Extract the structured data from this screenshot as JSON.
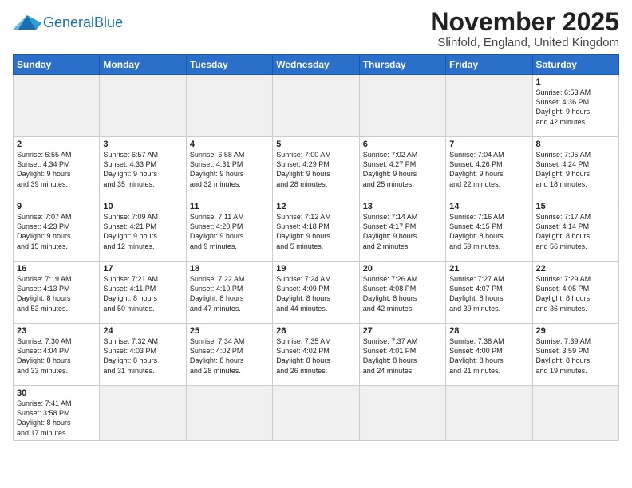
{
  "header": {
    "logo_general": "General",
    "logo_blue": "Blue",
    "month": "November 2025",
    "location": "Slinfold, England, United Kingdom"
  },
  "days_of_week": [
    "Sunday",
    "Monday",
    "Tuesday",
    "Wednesday",
    "Thursday",
    "Friday",
    "Saturday"
  ],
  "weeks": [
    [
      {
        "day": "",
        "info": "",
        "empty": true
      },
      {
        "day": "",
        "info": "",
        "empty": true
      },
      {
        "day": "",
        "info": "",
        "empty": true
      },
      {
        "day": "",
        "info": "",
        "empty": true
      },
      {
        "day": "",
        "info": "",
        "empty": true
      },
      {
        "day": "",
        "info": "",
        "empty": true
      },
      {
        "day": "1",
        "info": "Sunrise: 6:53 AM\nSunset: 4:36 PM\nDaylight: 9 hours\nand 42 minutes.",
        "empty": false
      }
    ],
    [
      {
        "day": "2",
        "info": "Sunrise: 6:55 AM\nSunset: 4:34 PM\nDaylight: 9 hours\nand 39 minutes.",
        "empty": false
      },
      {
        "day": "3",
        "info": "Sunrise: 6:57 AM\nSunset: 4:33 PM\nDaylight: 9 hours\nand 35 minutes.",
        "empty": false
      },
      {
        "day": "4",
        "info": "Sunrise: 6:58 AM\nSunset: 4:31 PM\nDaylight: 9 hours\nand 32 minutes.",
        "empty": false
      },
      {
        "day": "5",
        "info": "Sunrise: 7:00 AM\nSunset: 4:29 PM\nDaylight: 9 hours\nand 28 minutes.",
        "empty": false
      },
      {
        "day": "6",
        "info": "Sunrise: 7:02 AM\nSunset: 4:27 PM\nDaylight: 9 hours\nand 25 minutes.",
        "empty": false
      },
      {
        "day": "7",
        "info": "Sunrise: 7:04 AM\nSunset: 4:26 PM\nDaylight: 9 hours\nand 22 minutes.",
        "empty": false
      },
      {
        "day": "8",
        "info": "Sunrise: 7:05 AM\nSunset: 4:24 PM\nDaylight: 9 hours\nand 18 minutes.",
        "empty": false
      }
    ],
    [
      {
        "day": "9",
        "info": "Sunrise: 7:07 AM\nSunset: 4:23 PM\nDaylight: 9 hours\nand 15 minutes.",
        "empty": false
      },
      {
        "day": "10",
        "info": "Sunrise: 7:09 AM\nSunset: 4:21 PM\nDaylight: 9 hours\nand 12 minutes.",
        "empty": false
      },
      {
        "day": "11",
        "info": "Sunrise: 7:11 AM\nSunset: 4:20 PM\nDaylight: 9 hours\nand 9 minutes.",
        "empty": false
      },
      {
        "day": "12",
        "info": "Sunrise: 7:12 AM\nSunset: 4:18 PM\nDaylight: 9 hours\nand 5 minutes.",
        "empty": false
      },
      {
        "day": "13",
        "info": "Sunrise: 7:14 AM\nSunset: 4:17 PM\nDaylight: 9 hours\nand 2 minutes.",
        "empty": false
      },
      {
        "day": "14",
        "info": "Sunrise: 7:16 AM\nSunset: 4:15 PM\nDaylight: 8 hours\nand 59 minutes.",
        "empty": false
      },
      {
        "day": "15",
        "info": "Sunrise: 7:17 AM\nSunset: 4:14 PM\nDaylight: 8 hours\nand 56 minutes.",
        "empty": false
      }
    ],
    [
      {
        "day": "16",
        "info": "Sunrise: 7:19 AM\nSunset: 4:13 PM\nDaylight: 8 hours\nand 53 minutes.",
        "empty": false
      },
      {
        "day": "17",
        "info": "Sunrise: 7:21 AM\nSunset: 4:11 PM\nDaylight: 8 hours\nand 50 minutes.",
        "empty": false
      },
      {
        "day": "18",
        "info": "Sunrise: 7:22 AM\nSunset: 4:10 PM\nDaylight: 8 hours\nand 47 minutes.",
        "empty": false
      },
      {
        "day": "19",
        "info": "Sunrise: 7:24 AM\nSunset: 4:09 PM\nDaylight: 8 hours\nand 44 minutes.",
        "empty": false
      },
      {
        "day": "20",
        "info": "Sunrise: 7:26 AM\nSunset: 4:08 PM\nDaylight: 8 hours\nand 42 minutes.",
        "empty": false
      },
      {
        "day": "21",
        "info": "Sunrise: 7:27 AM\nSunset: 4:07 PM\nDaylight: 8 hours\nand 39 minutes.",
        "empty": false
      },
      {
        "day": "22",
        "info": "Sunrise: 7:29 AM\nSunset: 4:05 PM\nDaylight: 8 hours\nand 36 minutes.",
        "empty": false
      }
    ],
    [
      {
        "day": "23",
        "info": "Sunrise: 7:30 AM\nSunset: 4:04 PM\nDaylight: 8 hours\nand 33 minutes.",
        "empty": false
      },
      {
        "day": "24",
        "info": "Sunrise: 7:32 AM\nSunset: 4:03 PM\nDaylight: 8 hours\nand 31 minutes.",
        "empty": false
      },
      {
        "day": "25",
        "info": "Sunrise: 7:34 AM\nSunset: 4:02 PM\nDaylight: 8 hours\nand 28 minutes.",
        "empty": false
      },
      {
        "day": "26",
        "info": "Sunrise: 7:35 AM\nSunset: 4:02 PM\nDaylight: 8 hours\nand 26 minutes.",
        "empty": false
      },
      {
        "day": "27",
        "info": "Sunrise: 7:37 AM\nSunset: 4:01 PM\nDaylight: 8 hours\nand 24 minutes.",
        "empty": false
      },
      {
        "day": "28",
        "info": "Sunrise: 7:38 AM\nSunset: 4:00 PM\nDaylight: 8 hours\nand 21 minutes.",
        "empty": false
      },
      {
        "day": "29",
        "info": "Sunrise: 7:39 AM\nSunset: 3:59 PM\nDaylight: 8 hours\nand 19 minutes.",
        "empty": false
      }
    ],
    [
      {
        "day": "30",
        "info": "Sunrise: 7:41 AM\nSunset: 3:58 PM\nDaylight: 8 hours\nand 17 minutes.",
        "empty": false
      },
      {
        "day": "",
        "info": "",
        "empty": true
      },
      {
        "day": "",
        "info": "",
        "empty": true
      },
      {
        "day": "",
        "info": "",
        "empty": true
      },
      {
        "day": "",
        "info": "",
        "empty": true
      },
      {
        "day": "",
        "info": "",
        "empty": true
      },
      {
        "day": "",
        "info": "",
        "empty": true
      }
    ]
  ]
}
